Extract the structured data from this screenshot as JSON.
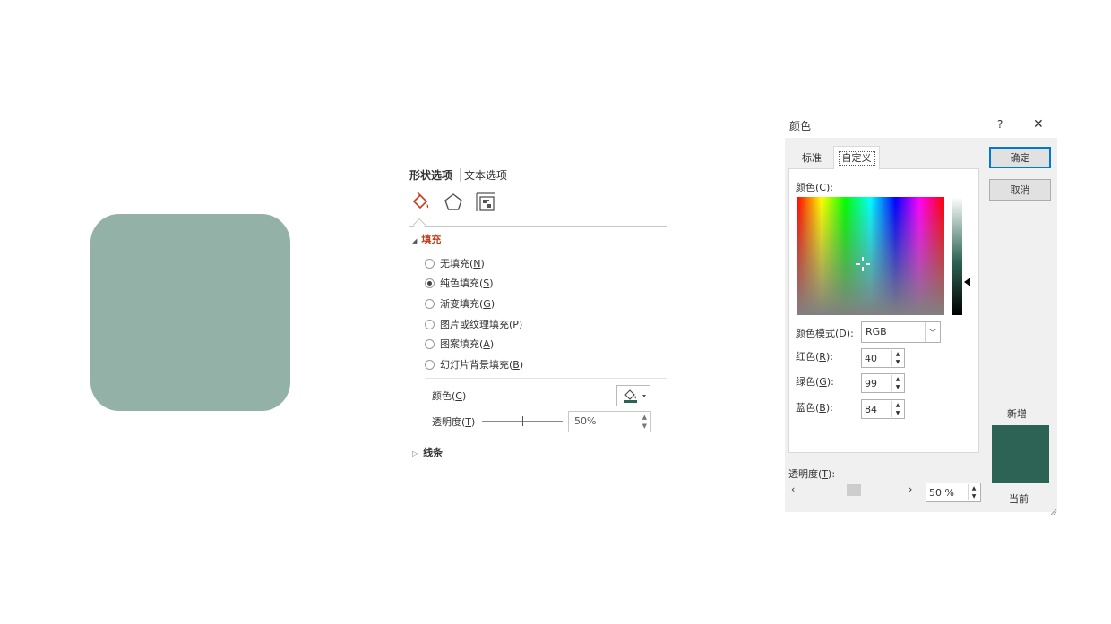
{
  "shape": {
    "fill": "#93b1a7"
  },
  "pane": {
    "tabs": [
      "形状选项",
      "文本选项"
    ],
    "icons": [
      "fill-bucket-icon",
      "pentagon-icon",
      "size-properties-icon"
    ],
    "fill_section": {
      "title": "填充",
      "options": [
        {
          "text": "无填充(",
          "key": "N",
          "checked": false
        },
        {
          "text": "纯色填充(",
          "key": "S",
          "checked": true
        },
        {
          "text": "渐变填充(",
          "key": "G",
          "checked": false
        },
        {
          "text": "图片或纹理填充(",
          "key": "P",
          "checked": false
        },
        {
          "text": "图案填充(",
          "key": "A",
          "checked": false
        },
        {
          "text": "幻灯片背景填充(",
          "key": "B",
          "checked": false
        }
      ],
      "color_label": {
        "text": "颜色(",
        "key": "C"
      },
      "transparency_label": {
        "text": "透明度(",
        "key": "T"
      },
      "transparency_value": "50%",
      "transparency_level": 0.5
    },
    "line_section": {
      "title": "线条"
    },
    "accent": "#c43e1c"
  },
  "dialog": {
    "title": "颜色",
    "help": "?",
    "close": "✕",
    "tabs": {
      "standard": "标准",
      "custom": "自定义"
    },
    "ok": "确定",
    "cancel": "取消",
    "colors_label": {
      "text": "颜色(",
      "key": "C",
      "suffix": "):"
    },
    "color_mode_label": {
      "text": "颜色模式(",
      "key": "D",
      "suffix": "):"
    },
    "color_mode_value": "RGB",
    "red_label": {
      "text": "红色(",
      "key": "R",
      "suffix": "):"
    },
    "green_label": {
      "text": "绿色(",
      "key": "G",
      "suffix": "):"
    },
    "blue_label": {
      "text": "蓝色(",
      "key": "B",
      "suffix": "):"
    },
    "red": "40",
    "green": "99",
    "blue": "84",
    "new_label": "新增",
    "current_label": "当前",
    "new_color": "#2d6354",
    "current_color": "#2d6354",
    "transparency_label": {
      "text": "透明度(",
      "key": "T",
      "suffix": "):"
    },
    "transparency_value": "50 %",
    "focus_color": "#0078d7"
  }
}
